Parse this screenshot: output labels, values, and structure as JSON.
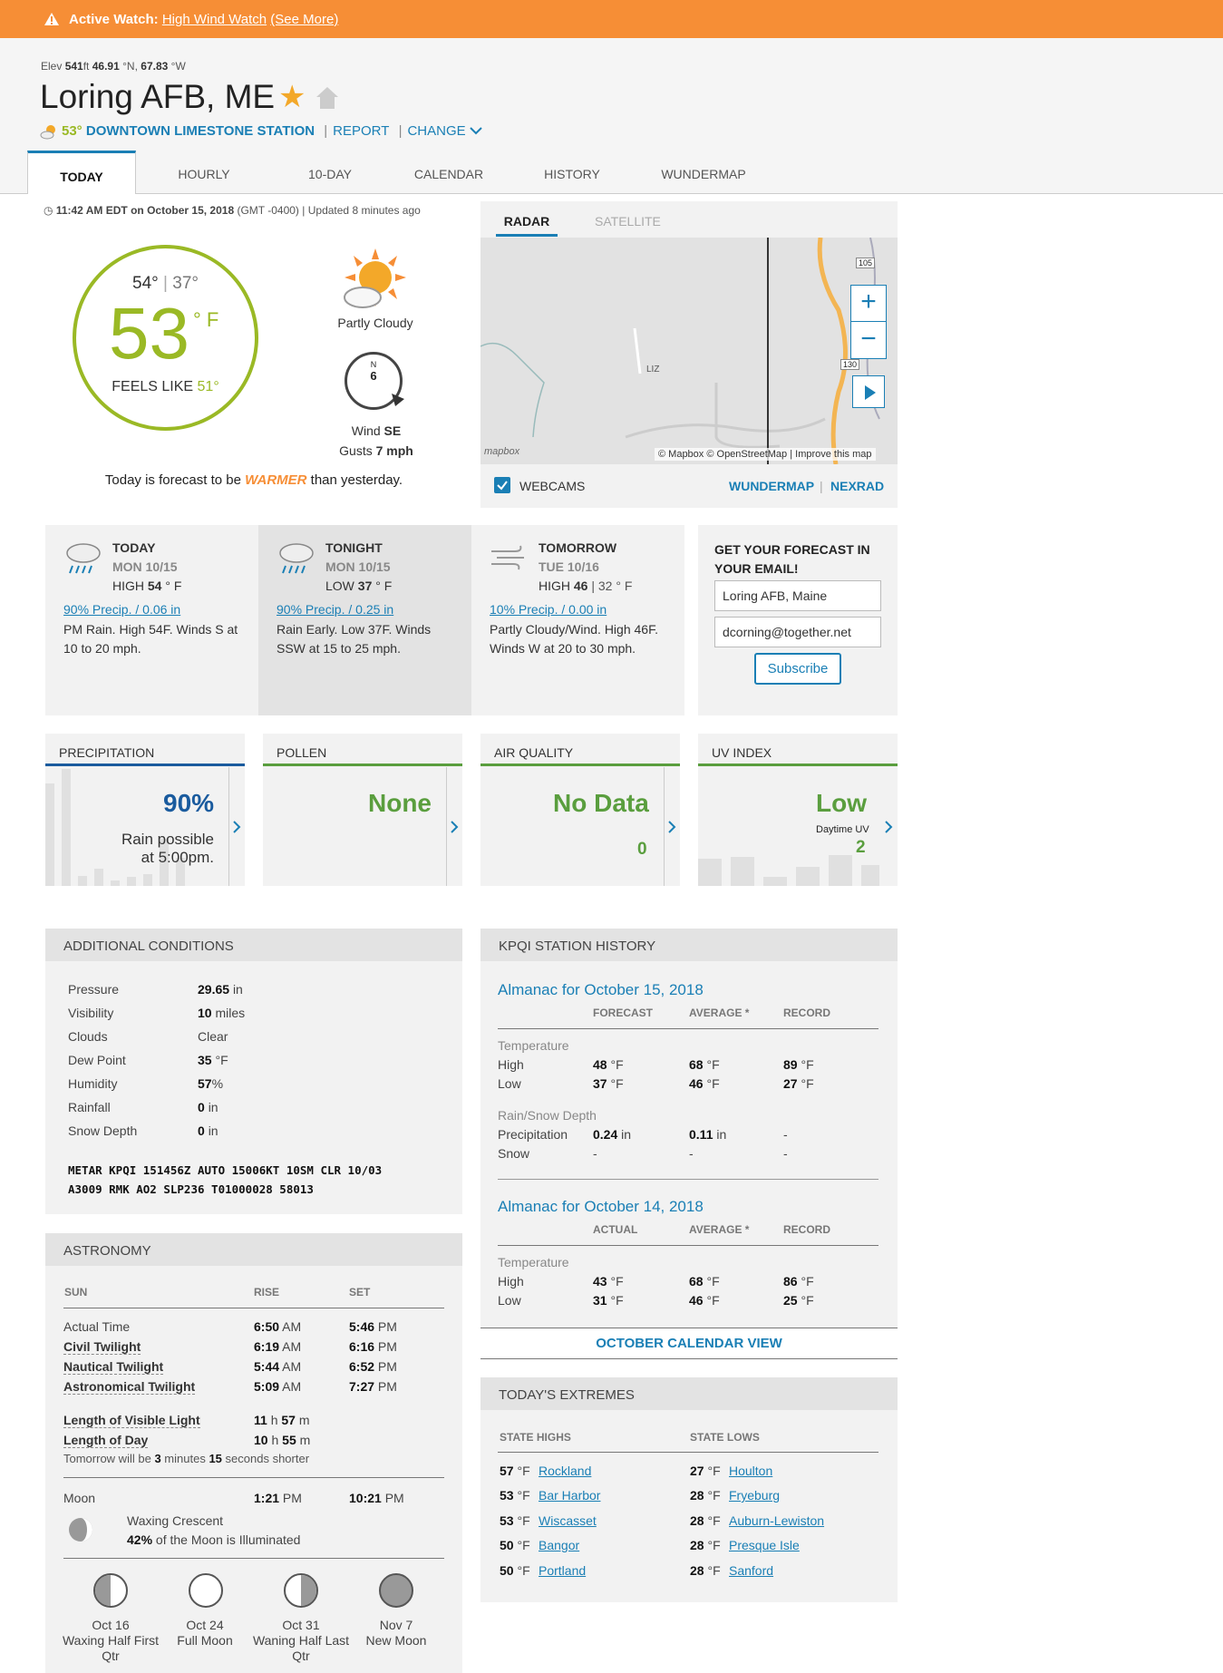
{
  "alert": {
    "label": "Active Watch:",
    "link": "High Wind Watch",
    "more": "(See More)"
  },
  "location": {
    "elev_label": "Elev",
    "elev": "541",
    "elev_unit": "ft",
    "lat": "46.91",
    "lat_unit": "°N,",
    "lon": "67.83",
    "lon_unit": "°W",
    "name": "Loring AFB, ME"
  },
  "station": {
    "temp": "53°",
    "name": "DOWNTOWN LIMESTONE STATION",
    "report": "REPORT",
    "change": "CHANGE"
  },
  "tabs": [
    "TODAY",
    "HOURLY",
    "10-DAY",
    "CALENDAR",
    "HISTORY",
    "WUNDERMAP"
  ],
  "current": {
    "time": "11:42 AM EDT on October 15, 2018",
    "tz": "(GMT -0400)",
    "updated": "Updated 8 minutes ago",
    "high": "54°",
    "low": "37°",
    "temp": "53",
    "unit": "° F",
    "feels_label": "FEELS LIKE",
    "feels": "51°",
    "condition": "Partly Cloudy",
    "compass_n": "N",
    "wind_speed": "6",
    "wind_label": "Wind",
    "wind_dir": "SE",
    "gusts_label": "Gusts",
    "gusts": "7 mph",
    "summary_pre": "Today is forecast to be",
    "summary_word": "WARMER",
    "summary_post": "than yesterday."
  },
  "radar": {
    "tab_radar": "RADAR",
    "tab_satellite": "SATELLITE",
    "credit": "© Mapbox © OpenStreetMap | Improve this map",
    "logo": "mapbox",
    "airport": "LIZ",
    "route1": "105",
    "route2": "130",
    "webcams": "WEBCAMS",
    "wundermap": "WUNDERMAP",
    "nexrad": "NEXRAD"
  },
  "forecast": [
    {
      "title": "TODAY",
      "date": "MON 10/15",
      "hl_label": "HIGH",
      "temp": "54",
      "unit": "° F",
      "extra": "",
      "precip": "90% Precip. / 0.06 in",
      "text": "PM Rain. High 54F. Winds S at 10 to 20 mph."
    },
    {
      "title": "TONIGHT",
      "date": "MON 10/15",
      "hl_label": "LOW",
      "temp": "37",
      "unit": "° F",
      "extra": "",
      "precip": "90% Precip. / 0.25 in",
      "text": "Rain Early. Low 37F. Winds SSW at 15 to 25 mph."
    },
    {
      "title": "TOMORROW",
      "date": "TUE 10/16",
      "hl_label": "HIGH",
      "temp": "46",
      "unit": "",
      "extra": "| 32 ° F",
      "precip": "10% Precip. / 0.00 in",
      "text": "Partly Cloudy/Wind. High 46F. Winds W at 20 to 30 mph."
    }
  ],
  "email": {
    "title1": "GET YOUR FORECAST IN",
    "title2": "YOUR EMAIL!",
    "location": "Loring AFB, Maine",
    "email": "dcorning@together.net",
    "subscribe": "Subscribe"
  },
  "cards": {
    "precip": {
      "title": "PRECIPITATION",
      "value": "90%",
      "line1": "Rain possible",
      "line2": "at 5:00pm."
    },
    "pollen": {
      "title": "POLLEN",
      "value": "None"
    },
    "air": {
      "title": "AIR QUALITY",
      "value": "No Data",
      "num": "0"
    },
    "uv": {
      "title": "UV INDEX",
      "value": "Low",
      "sub": "Daytime UV",
      "num": "2"
    }
  },
  "conditions": {
    "title": "ADDITIONAL CONDITIONS",
    "rows": [
      {
        "label": "Pressure",
        "value": "29.65",
        "unit": "in"
      },
      {
        "label": "Visibility",
        "value": "10",
        "unit": "miles"
      },
      {
        "label": "Clouds",
        "value": "",
        "unit": "Clear"
      },
      {
        "label": "Dew Point",
        "value": "35",
        "unit": "°F"
      },
      {
        "label": "Humidity",
        "value": "57",
        "unit": "%"
      },
      {
        "label": "Rainfall",
        "value": "0",
        "unit": "in"
      },
      {
        "label": "Snow Depth",
        "value": "0",
        "unit": "in"
      }
    ],
    "metar1": "METAR KPQI 151456Z AUTO 15006KT 10SM CLR 10/03",
    "metar2": "A3009 RMK AO2 SLP236 T01000028 58013"
  },
  "history": {
    "title": "KPQI STATION HISTORY",
    "alm1": {
      "title": "Almanac for October 15, 2018",
      "c1": "FORECAST",
      "c2": "AVERAGE *",
      "c3": "RECORD",
      "temp_label": "Temperature",
      "high": {
        "l": "High",
        "a": "48",
        "b": "68",
        "c": "89"
      },
      "low": {
        "l": "Low",
        "a": "37",
        "b": "46",
        "c": "27"
      },
      "rain_label": "Rain/Snow Depth",
      "precip": {
        "l": "Precipitation",
        "a": "0.24",
        "b": "0.11",
        "c": "-"
      },
      "snow": {
        "l": "Snow",
        "a": "-",
        "b": "-",
        "c": "-"
      }
    },
    "alm2": {
      "title": "Almanac for October 14, 2018",
      "c1": "ACTUAL",
      "c2": "AVERAGE *",
      "c3": "RECORD",
      "temp_label": "Temperature",
      "high": {
        "l": "High",
        "a": "43",
        "b": "68",
        "c": "86"
      },
      "low": {
        "l": "Low",
        "a": "31",
        "b": "46",
        "c": "25"
      }
    },
    "calendar": "OCTOBER CALENDAR VIEW",
    "deg": "°F",
    "in": "in"
  },
  "astronomy": {
    "title": "ASTRONOMY",
    "h_sun": "SUN",
    "h_rise": "RISE",
    "h_set": "SET",
    "rows": [
      {
        "label": "Actual Time",
        "rise": "6:50",
        "rp": "AM",
        "set": "5:46",
        "sp": "PM"
      },
      {
        "label": "Civil Twilight",
        "rise": "6:19",
        "rp": "AM",
        "set": "6:16",
        "sp": "PM"
      },
      {
        "label": "Nautical Twilight",
        "rise": "5:44",
        "rp": "AM",
        "set": "6:52",
        "sp": "PM"
      },
      {
        "label": "Astronomical Twilight",
        "rise": "5:09",
        "rp": "AM",
        "set": "7:27",
        "sp": "PM"
      }
    ],
    "vis_label": "Length of Visible Light",
    "vis_h": "11",
    "vis_m": "57",
    "day_label": "Length of Day",
    "day_h": "10",
    "day_m": "55",
    "h": "h",
    "m": "m",
    "tomorrow_pre": "Tomorrow will be",
    "tomorrow_min": "3",
    "tomorrow_mid": "minutes",
    "tomorrow_sec": "15",
    "tomorrow_post": "seconds shorter",
    "moon_label": "Moon",
    "moon_rise": "1:21",
    "moon_rp": "PM",
    "moon_set": "10:21",
    "moon_sp": "PM",
    "phase": "Waxing Crescent",
    "illum": "42%",
    "illum_text": "of the Moon is Illuminated",
    "phases": [
      {
        "date": "Oct 16",
        "name": "Waxing Half First Qtr"
      },
      {
        "date": "Oct 24",
        "name": "Full Moon"
      },
      {
        "date": "Oct 31",
        "name": "Waning Half Last Qtr"
      },
      {
        "date": "Nov 7",
        "name": "New Moon"
      }
    ]
  },
  "extremes": {
    "title": "TODAY'S EXTREMES",
    "highs_label": "STATE HIGHS",
    "lows_label": "STATE LOWS",
    "unit": "°F",
    "highs": [
      {
        "t": "57",
        "c": "Rockland"
      },
      {
        "t": "53",
        "c": "Bar Harbor"
      },
      {
        "t": "53",
        "c": "Wiscasset"
      },
      {
        "t": "50",
        "c": "Bangor"
      },
      {
        "t": "50",
        "c": "Portland"
      }
    ],
    "lows": [
      {
        "t": "27",
        "c": "Houlton"
      },
      {
        "t": "28",
        "c": "Fryeburg"
      },
      {
        "t": "28",
        "c": "Auburn-Lewiston"
      },
      {
        "t": "28",
        "c": "Presque Isle"
      },
      {
        "t": "28",
        "c": "Sanford"
      }
    ]
  }
}
